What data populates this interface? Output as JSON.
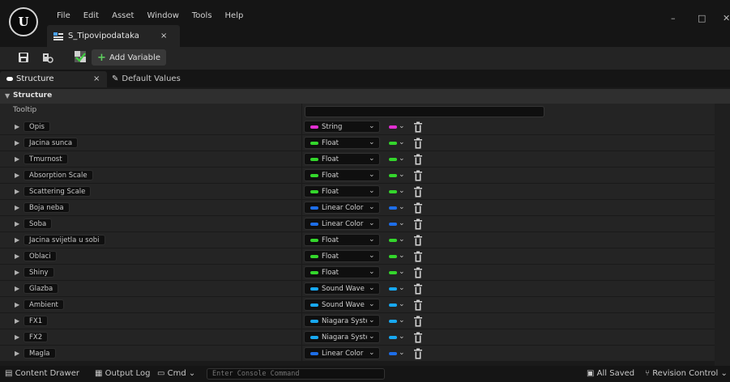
{
  "menu": [
    "File",
    "Edit",
    "Asset",
    "Window",
    "Tools",
    "Help"
  ],
  "asset_tab": {
    "label": "S_Tipovipodataka",
    "close": "×"
  },
  "window_controls": {
    "minimize": "–",
    "maximize": "□",
    "close": "✕"
  },
  "toolbar": {
    "add_variable_label": "Add Variable",
    "add_icon": "+"
  },
  "panel_tabs": {
    "structure_label": "Structure",
    "structure_close": "×",
    "default_values_label": "Default Values"
  },
  "section": {
    "label": "Structure"
  },
  "tooltip": {
    "label": "Tooltip",
    "value": ""
  },
  "colors": {
    "string": "#e22fd2",
    "float": "#34d62c",
    "linear_color": "#1e6ee8",
    "sound_wave": "#18a8f0",
    "niagara": "#18a8f0"
  },
  "variables": [
    {
      "name": "Opis",
      "type": "String",
      "color": "#e22fd2"
    },
    {
      "name": "Jacina sunca",
      "type": "Float",
      "color": "#34d62c"
    },
    {
      "name": "Tmurnost",
      "type": "Float",
      "color": "#34d62c"
    },
    {
      "name": "Absorption Scale",
      "type": "Float",
      "color": "#34d62c"
    },
    {
      "name": "Scattering Scale",
      "type": "Float",
      "color": "#34d62c"
    },
    {
      "name": "Boja neba",
      "type": "Linear Color",
      "color": "#1e6ee8"
    },
    {
      "name": "Soba",
      "type": "Linear Color",
      "color": "#1e6ee8"
    },
    {
      "name": "Jacina svijetla u sobi",
      "type": "Float",
      "color": "#34d62c"
    },
    {
      "name": "Oblaci",
      "type": "Float",
      "color": "#34d62c"
    },
    {
      "name": "Shiny",
      "type": "Float",
      "color": "#34d62c"
    },
    {
      "name": "Glazba",
      "type": "Sound Wave",
      "color": "#18a8f0"
    },
    {
      "name": "Ambient",
      "type": "Sound Wave",
      "color": "#18a8f0"
    },
    {
      "name": "FX1",
      "type": "Niagara Syste",
      "color": "#18a8f0"
    },
    {
      "name": "FX2",
      "type": "Niagara Syste",
      "color": "#18a8f0"
    },
    {
      "name": "Magla",
      "type": "Linear Color",
      "color": "#1e6ee8"
    }
  ],
  "statusbar": {
    "content_drawer": "Content Drawer",
    "output_log": "Output Log",
    "cmd": "Cmd",
    "console_placeholder": "Enter Console Command",
    "all_saved": "All Saved",
    "revision_control": "Revision Control"
  }
}
